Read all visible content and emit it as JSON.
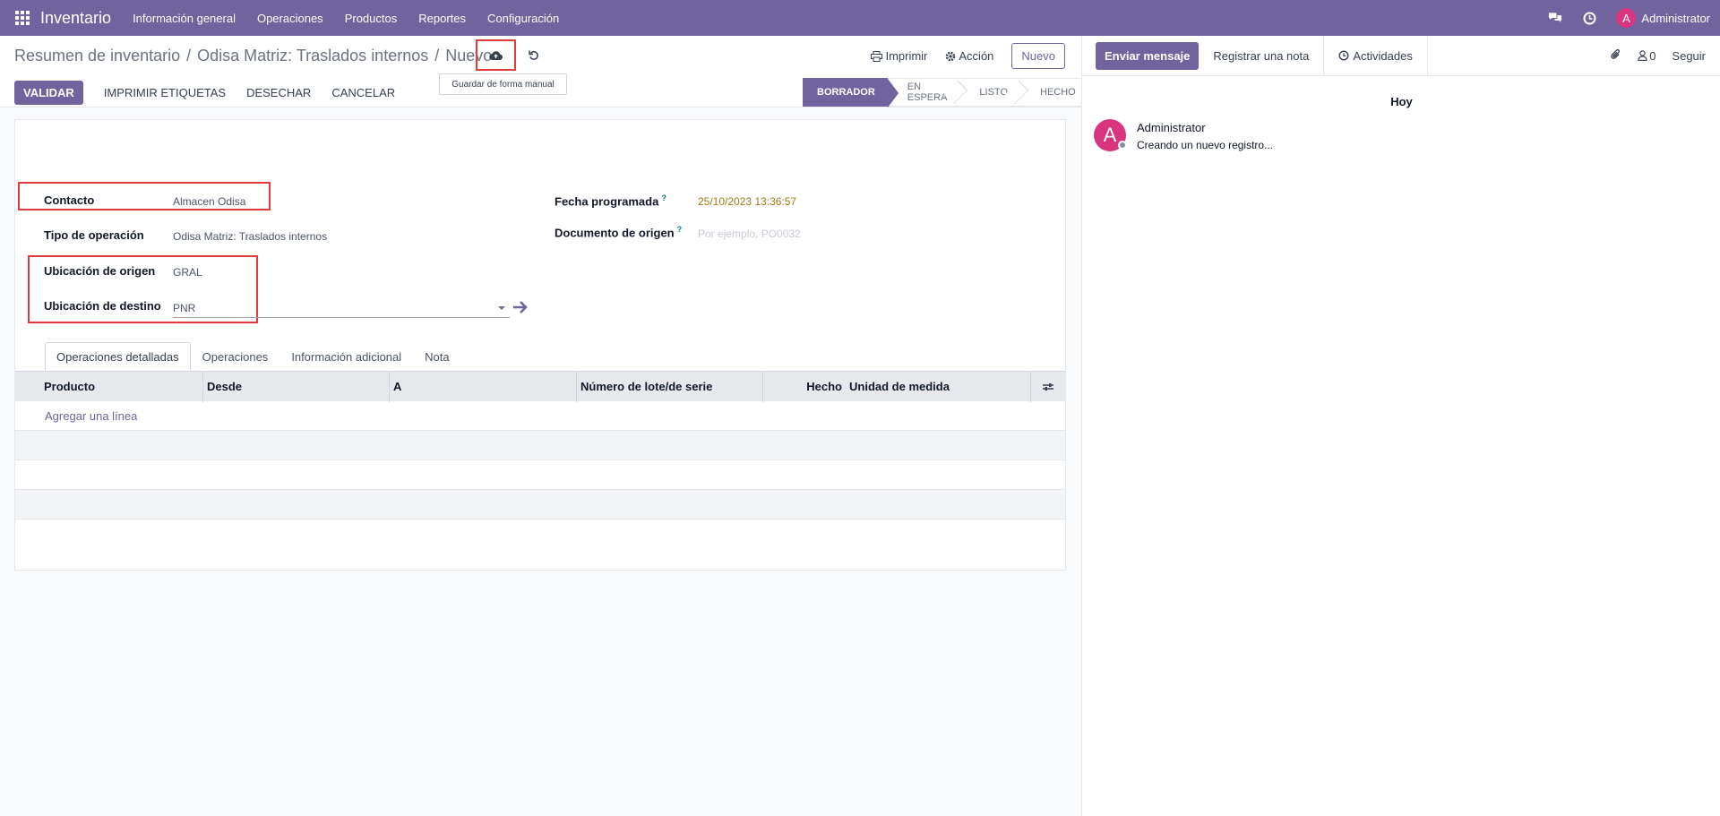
{
  "navbar": {
    "brand": "Inventario",
    "menu": [
      "Información general",
      "Operaciones",
      "Productos",
      "Reportes",
      "Configuración"
    ],
    "user_initial": "A",
    "user_name": "Administrator"
  },
  "control": {
    "breadcrumb": [
      "Resumen de inventario",
      "Odisa Matriz: Traslados internos",
      "Nuevo"
    ],
    "tooltip": "Guardar de forma manual",
    "print_label": "Imprimir",
    "action_label": "Acción",
    "new_label": "Nuevo",
    "buttons": {
      "validate": "VALIDAR",
      "print_labels": "IMPRIMIR ETIQUETAS",
      "discard": "DESECHAR",
      "cancel": "CANCELAR"
    },
    "stages": [
      "BORRADOR",
      "EN ESPERA",
      "LISTO",
      "HECHO"
    ],
    "active_stage": "BORRADOR"
  },
  "form": {
    "contact_label": "Contacto",
    "contact_value": "Almacen Odisa",
    "op_type_label": "Tipo de operación",
    "op_type_value": "Odisa Matriz: Traslados internos",
    "src_label": "Ubicación de origen",
    "src_value": "GRAL",
    "dest_label": "Ubicación de destino",
    "dest_value": "PNR",
    "date_label": "Fecha programada",
    "date_value": "25/10/2023 13:36:57",
    "origin_label": "Documento de origen",
    "origin_placeholder": "Por ejemplo, PO0032",
    "help_mark": "?"
  },
  "tabs": [
    "Operaciones detalladas",
    "Operaciones",
    "Información adicional",
    "Nota"
  ],
  "table": {
    "columns": [
      "Producto",
      "Desde",
      "A",
      "Número de lote/de serie",
      "Hecho",
      "Unidad de medida"
    ],
    "add_line": "Agregar una línea"
  },
  "chatter": {
    "send_message": "Enviar mensaje",
    "log_note": "Registrar una nota",
    "activities": "Actividades",
    "followers_count": "0",
    "follow": "Seguir",
    "today": "Hoy",
    "message_author": "Administrator",
    "message_text": "Creando un nuevo registro...",
    "avatar_initial": "A"
  },
  "colors": {
    "primary": "#71639e",
    "highlight": "#e23b3b",
    "date": "#a27b15",
    "avatar": "#d9347e"
  }
}
